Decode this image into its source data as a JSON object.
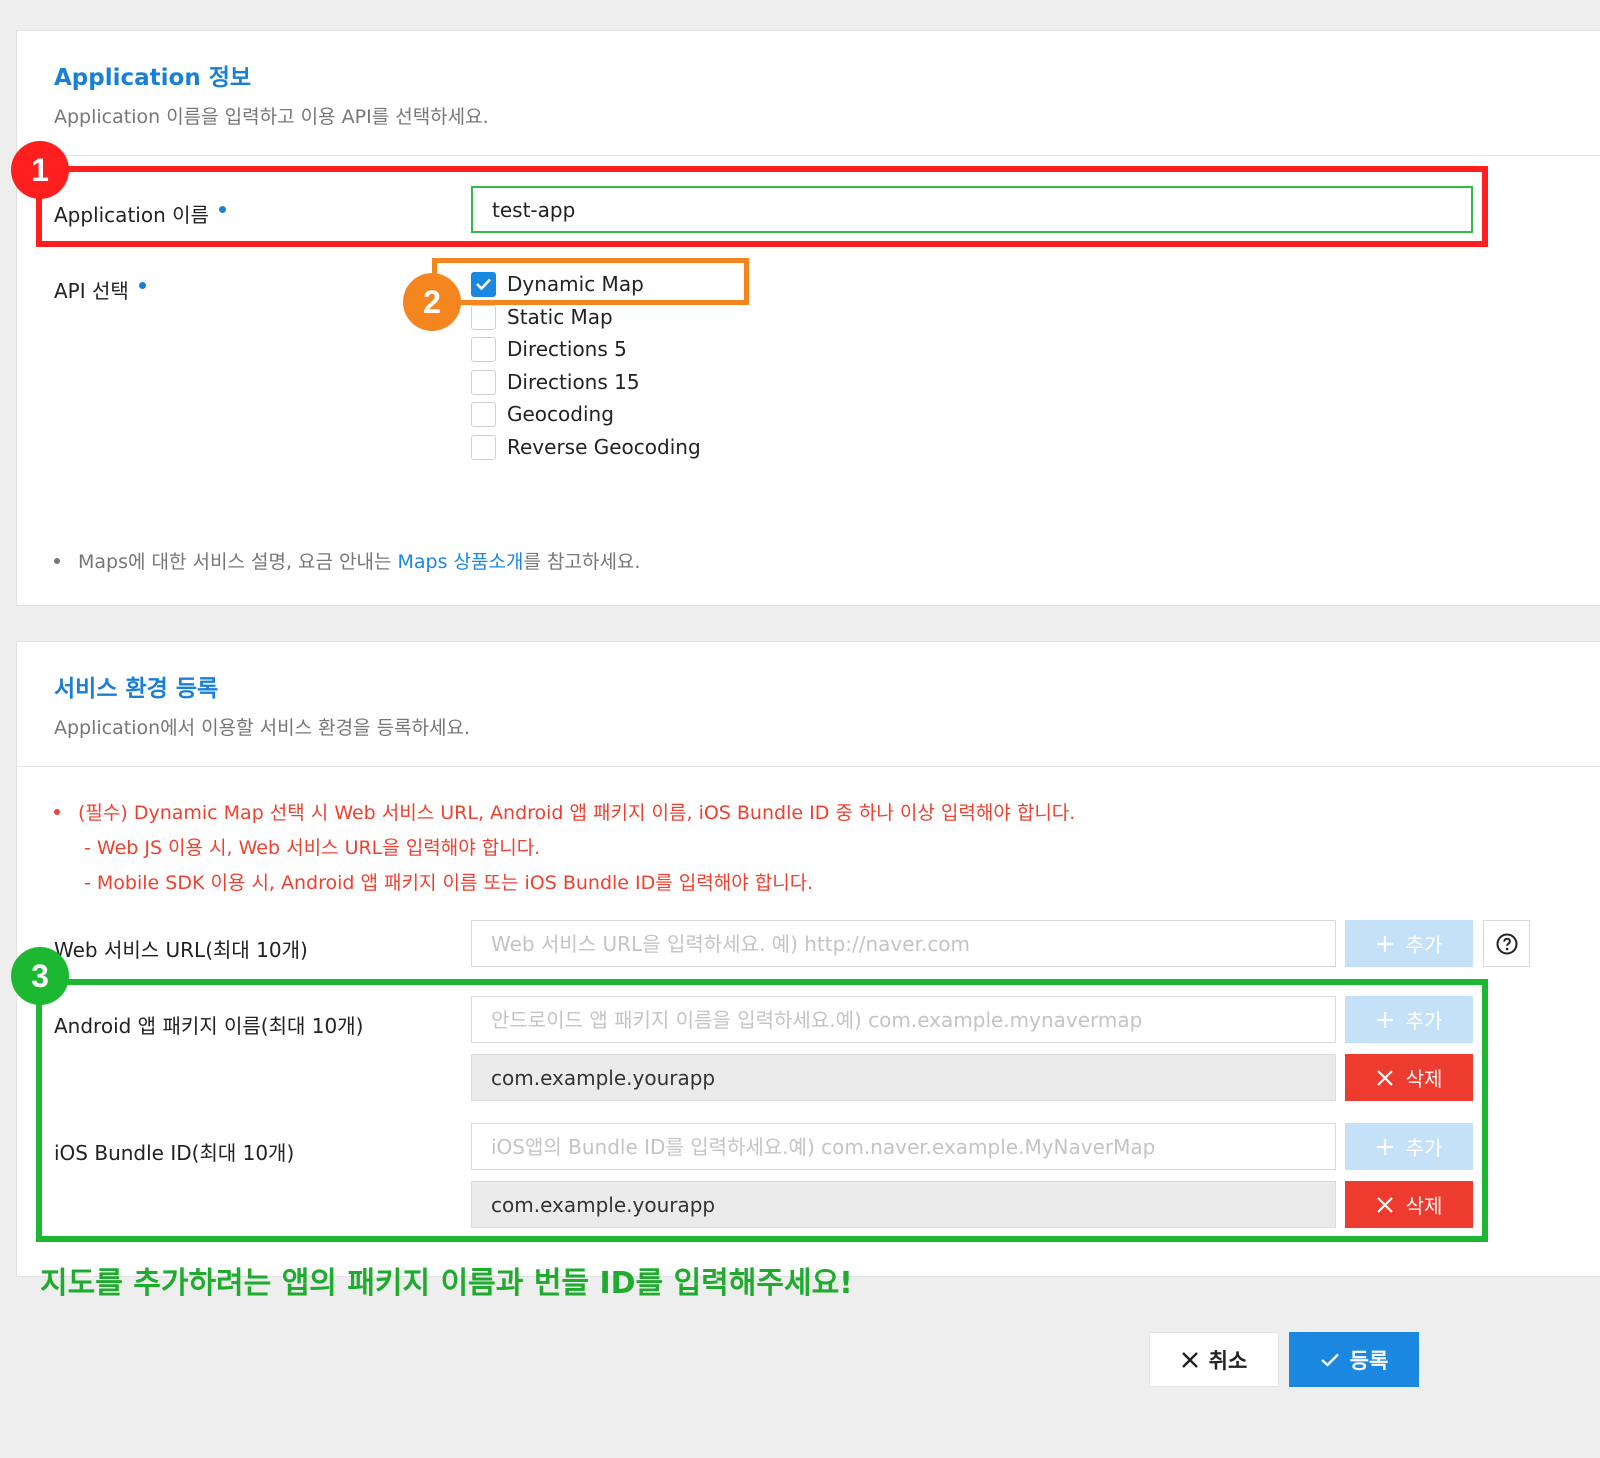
{
  "app_info": {
    "title": "Application 정보",
    "description": "Application 이름을 입력하고 이용 API를 선택하세요.",
    "name_label": "Application 이름",
    "name_value": "test-app",
    "api_label": "API 선택",
    "apis": [
      {
        "label": "Dynamic Map",
        "checked": true
      },
      {
        "label": "Static Map",
        "checked": false
      },
      {
        "label": "Directions 5",
        "checked": false
      },
      {
        "label": "Directions 15",
        "checked": false
      },
      {
        "label": "Geocoding",
        "checked": false
      },
      {
        "label": "Reverse Geocoding",
        "checked": false
      }
    ],
    "note_prefix": "Maps에 대한 서비스 설명, 요금 안내는 ",
    "note_link": "Maps 상품소개",
    "note_suffix": "를 참고하세요."
  },
  "service_env": {
    "title": "서비스 환경 등록",
    "description": "Application에서 이용할 서비스 환경을 등록하세요.",
    "notes": [
      "(필수) Dynamic Map 선택 시 Web 서비스 URL, Android 앱 패키지 이름, iOS Bundle ID 중 하나 이상 입력해야 합니다.",
      "- Web JS 이용 시, Web 서비스 URL을 입력해야 합니다.",
      "- Mobile SDK 이용 시, Android 앱 패키지 이름 또는 iOS Bundle ID를 입력해야 합니다."
    ],
    "web_label": "Web 서비스 URL(최대 10개)",
    "web_placeholder": "Web 서비스 URL을 입력하세요. 예) http://naver.com",
    "android_label": "Android 앱 패키지 이름(최대 10개)",
    "android_placeholder": "안드로이드 앱 패키지 이름을 입력하세요.예) com.example.mynavermap",
    "android_value": "com.example.yourapp",
    "ios_label": "iOS Bundle ID(최대 10개)",
    "ios_placeholder": "iOS앱의 Bundle ID를 입력하세요.예) com.naver.example.MyNaverMap",
    "ios_value": "com.example.yourapp",
    "add_label": "추가",
    "delete_label": "삭제"
  },
  "annotations": {
    "badge1": "1",
    "badge2": "2",
    "badge3": "3",
    "caption": "지도를 추가하려는 앱의 패키지 이름과 번들 ID를 입력해주세요!",
    "colors": {
      "red": "#ff1f1f",
      "orange": "#f5861f",
      "green": "#1cb832"
    }
  },
  "footer": {
    "cancel_label": "취소",
    "submit_label": "등록"
  },
  "icons": [
    "check-icon",
    "plus-icon",
    "close-icon",
    "help-icon",
    "bullet-icon"
  ]
}
